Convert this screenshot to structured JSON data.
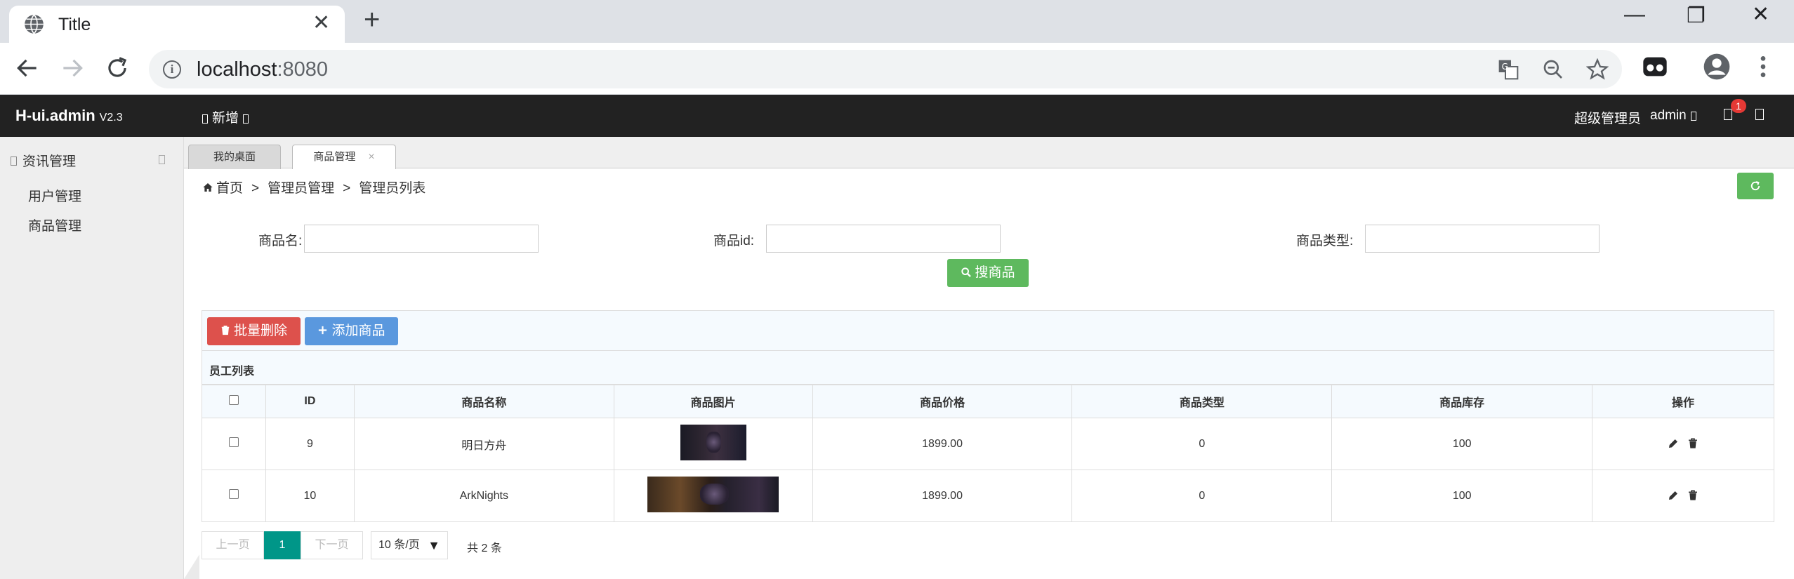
{
  "browser": {
    "tab_title": "Title",
    "url_host": "localhost",
    "url_port": ":8080"
  },
  "header": {
    "logo": "H-ui.admin",
    "version": "V2.3",
    "add_menu": "新增",
    "role": "超级管理员",
    "user": "admin",
    "message_count": "1"
  },
  "sidebar": {
    "group": "资讯管理",
    "items": [
      {
        "label": "用户管理"
      },
      {
        "label": "商品管理"
      }
    ]
  },
  "tabs": [
    {
      "label": "我的桌面"
    },
    {
      "label": "商品管理",
      "close": "×"
    }
  ],
  "breadcrumb": {
    "home": "首页",
    "sep": ">",
    "level1": "管理员管理",
    "level2": "管理员列表"
  },
  "search": {
    "name_label": "商品名:",
    "id_label": "商品id:",
    "type_label": "商品类型:",
    "button": "搜商品"
  },
  "actions": {
    "batch_delete": "批量删除",
    "add": "添加商品"
  },
  "table": {
    "caption": "员工列表",
    "columns": [
      "ID",
      "商品名称",
      "商品图片",
      "商品价格",
      "商品类型",
      "商品库存",
      "操作"
    ],
    "rows": [
      {
        "id": "9",
        "name": "明日方舟",
        "price": "1899.00",
        "type": "0",
        "stock": "100"
      },
      {
        "id": "10",
        "name": "ArkNights",
        "price": "1899.00",
        "type": "0",
        "stock": "100"
      }
    ]
  },
  "pager": {
    "prev": "上一页",
    "current": "1",
    "next": "下一页",
    "page_size": "10 条/页",
    "total": "共 2 条"
  },
  "colors": {
    "header_bg": "#222222",
    "success": "#5eb95e",
    "danger": "#dd514c",
    "primary": "#5a98de",
    "pager_active": "#009688"
  }
}
